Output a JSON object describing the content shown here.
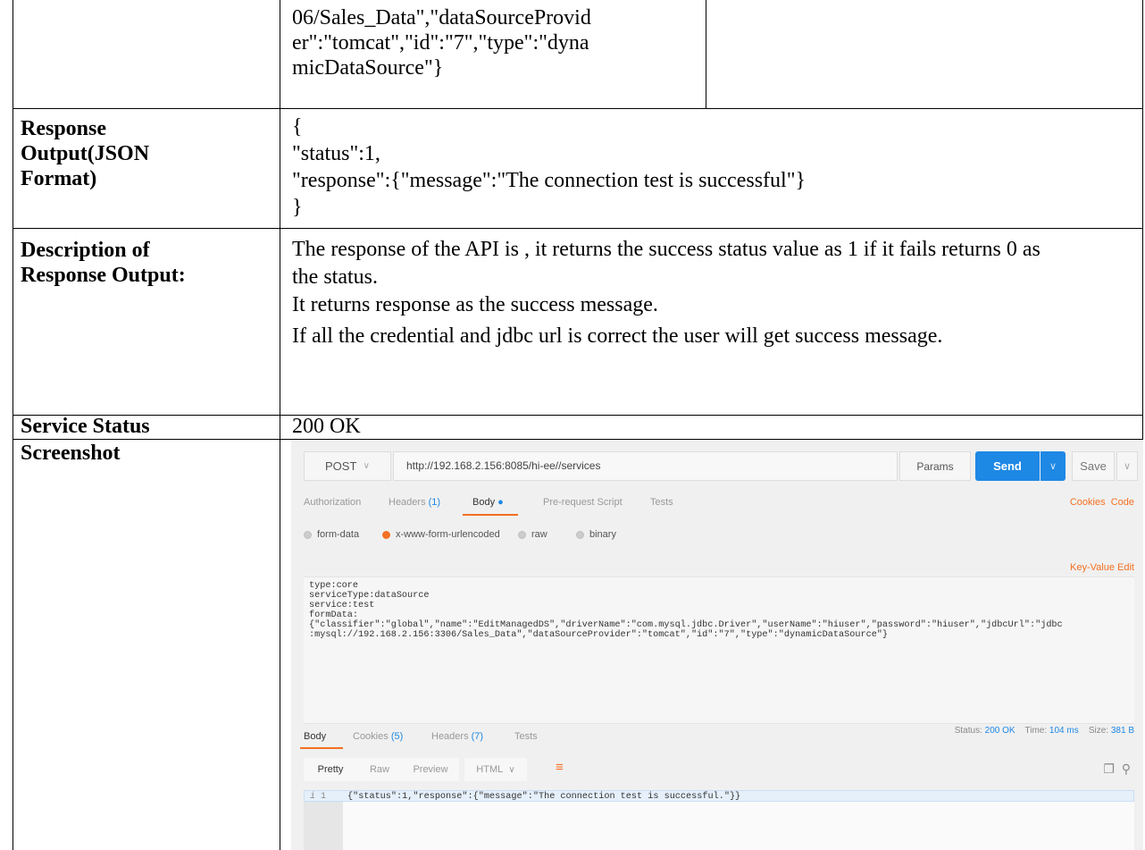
{
  "rows": {
    "request_cell": {
      "lines": [
        "06/Sales_Data\",\"dataSourceProvid",
        "er\":\"tomcat\",\"id\":\"7\",\"type\":\"dyna",
        "micDataSource\"}"
      ]
    },
    "response_output": {
      "label_lines": [
        "Response",
        "Output(JSON",
        "Format)"
      ],
      "value_lines": [
        "{",
        "\"status\":1,",
        "\"response\":{\"message\":\"The connection test is successful\"}",
        "}"
      ]
    },
    "description": {
      "label_lines": [
        "Description of",
        "Response Output:"
      ],
      "paragraphs": [
        "The response of the API is , it returns the success status value as 1 if it fails returns 0 as the status.",
        "It returns response as the success message.",
        "If all the credential and jdbc url is correct the user will get success message."
      ]
    },
    "service_status": {
      "label": "Service Status",
      "value": "200 OK"
    },
    "screenshot": {
      "label": "Screenshot"
    }
  },
  "postman": {
    "method": "POST",
    "url": "http://192.168.2.156:8085/hi-ee//services",
    "params_label": "Params",
    "send_label": "Send",
    "save_label": "Save",
    "request_tabs": [
      {
        "label": "Authorization",
        "count": ""
      },
      {
        "label": "Headers",
        "count": "(1)"
      },
      {
        "label": "Body",
        "count": ""
      },
      {
        "label": "Pre-request Script",
        "count": ""
      },
      {
        "label": "Tests",
        "count": ""
      }
    ],
    "cookies_link": "Cookies",
    "code_link": "Code",
    "body_types": [
      "form-data",
      "x-www-form-urlencoded",
      "raw",
      "binary"
    ],
    "selected_body_type": "x-www-form-urlencoded",
    "key_value_edit": "Key-Value Edit",
    "request_body": "type:core\nserviceType:dataSource\nservice:test\nformData:\n{\"classifier\":\"global\",\"name\":\"EditManagedDS\",\"driverName\":\"com.mysql.jdbc.Driver\",\"userName\":\"hiuser\",\"password\":\"hiuser\",\"jdbcUrl\":\"jdbc\n:mysql://192.168.2.156:3306/Sales_Data\",\"dataSourceProvider\":\"tomcat\",\"id\":\"7\",\"type\":\"dynamicDataSource\"}",
    "response_tabs": [
      {
        "label": "Body",
        "count": ""
      },
      {
        "label": "Cookies",
        "count": "(5)"
      },
      {
        "label": "Headers",
        "count": "(7)"
      },
      {
        "label": "Tests",
        "count": ""
      }
    ],
    "status_label": "Status:",
    "status_value": "200 OK",
    "time_label": "Time:",
    "time_value": "104 ms",
    "size_label": "Size:",
    "size_value": "381 B",
    "view_modes": [
      "Pretty",
      "Raw",
      "Preview"
    ],
    "format": "HTML",
    "line_number": "1",
    "response_body": "{\"status\":1,\"response\":{\"message\":\"The connection test is successful.\"}}",
    "accent_color": "#f47023",
    "send_color": "#1e88e5"
  }
}
